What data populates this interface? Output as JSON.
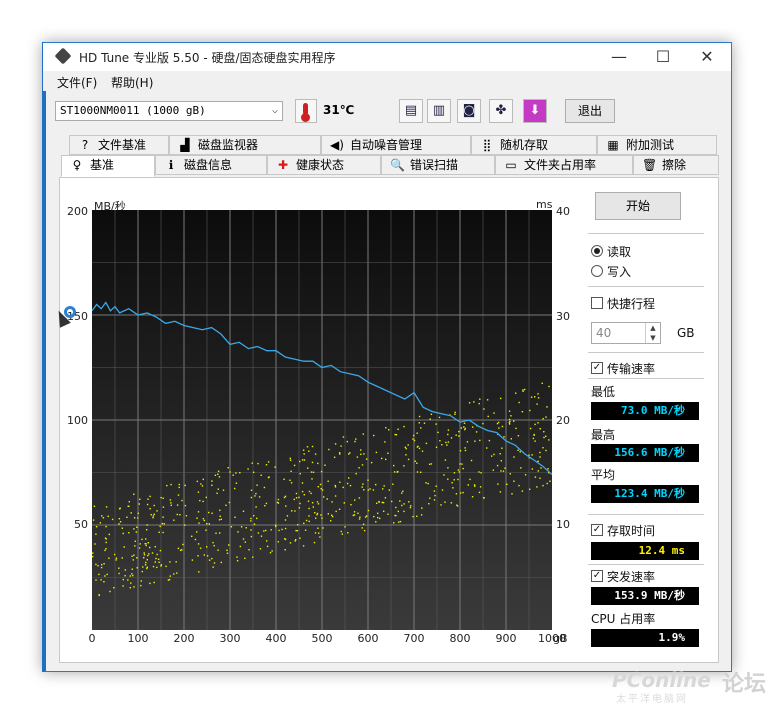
{
  "window": {
    "title": "HD Tune 专业版 5.50 - 硬盘/固态硬盘实用程序",
    "min_label": "—",
    "max_label": "☐",
    "close_label": "✕"
  },
  "menu": {
    "items": [
      {
        "label": "文件(F)"
      },
      {
        "label": "帮助(H)"
      }
    ]
  },
  "toolbar": {
    "drive": "ST1000NM0011 (1000 gB)",
    "temperature": "31℃",
    "exit_label": "退出",
    "icons": [
      {
        "name": "copy-info-icon",
        "glyph": "▤"
      },
      {
        "name": "copy-text-icon",
        "glyph": "▥"
      },
      {
        "name": "camera-icon",
        "glyph": "◙"
      },
      {
        "name": "options-icon",
        "glyph": "✤"
      },
      {
        "name": "save-down-icon",
        "glyph": "⬇"
      }
    ]
  },
  "tabs": {
    "row1": [
      {
        "label": "文件基准",
        "icon": "?"
      },
      {
        "label": "磁盘监视器",
        "icon": "▟"
      },
      {
        "label": "自动噪音管理",
        "icon": "◀)"
      },
      {
        "label": "随机存取",
        "icon": "⣿"
      },
      {
        "label": "附加测试",
        "icon": "▦"
      }
    ],
    "row2": [
      {
        "label": "基准",
        "icon": "♀"
      },
      {
        "label": "磁盘信息",
        "icon": "ℹ"
      },
      {
        "label": "健康状态",
        "icon": "✚"
      },
      {
        "label": "错误扫描",
        "icon": "🔍"
      },
      {
        "label": "文件夹占用率",
        "icon": "▭"
      },
      {
        "label": "擦除",
        "icon": "🗑"
      }
    ]
  },
  "side": {
    "start_label": "开始",
    "read_label": "读取",
    "write_label": "写入",
    "quick_label": "快捷行程",
    "quick_value": "40",
    "quick_unit": "GB",
    "transfer_label": "传输速率",
    "min_label": "最低",
    "min_value": "73.0 MB/秒",
    "max_label": "最高",
    "max_value": "156.6 MB/秒",
    "avg_label": "平均",
    "avg_value": "123.4 MB/秒",
    "access_label": "存取时间",
    "access_value": "12.4 ms",
    "burst_label": "突发速率",
    "burst_value": "153.9 MB/秒",
    "cpu_label": "CPU 占用率",
    "cpu_value": "1.9%"
  },
  "watermark": {
    "brand": "PConline",
    "sub": "太平洋电脑网",
    "forum": "论坛"
  },
  "chart_data": {
    "type": "line",
    "ylabel": "MB/秒",
    "y2label": "ms",
    "xunit": "gB",
    "xlim": [
      0,
      1000
    ],
    "ylim": [
      0,
      200
    ],
    "y2lim": [
      0,
      40
    ],
    "xticks": [
      "0",
      "100",
      "200",
      "300",
      "400",
      "500",
      "600",
      "700",
      "800",
      "900",
      "1000"
    ],
    "yticks": [
      "200",
      "150",
      "100",
      "50"
    ],
    "y2ticks": [
      "40",
      "30",
      "20",
      "10"
    ],
    "grid": true,
    "series": [
      {
        "kind": "line",
        "color": "#3aa8e8",
        "x": [
          0,
          10,
          20,
          30,
          40,
          50,
          60,
          80,
          100,
          120,
          140,
          160,
          180,
          200,
          220,
          240,
          260,
          280,
          300,
          320,
          340,
          360,
          380,
          400,
          420,
          440,
          460,
          480,
          500,
          520,
          540,
          560,
          580,
          600,
          620,
          640,
          660,
          680,
          700,
          720,
          740,
          760,
          780,
          800,
          820,
          840,
          860,
          880,
          900,
          920,
          940,
          960,
          980,
          1000
        ],
        "y": [
          152,
          155,
          153,
          156,
          152,
          154,
          151,
          153,
          150,
          151,
          149,
          146,
          147,
          145,
          144,
          143,
          144,
          141,
          136,
          137,
          134,
          135,
          133,
          133,
          130,
          129,
          128,
          128,
          125,
          126,
          123,
          122,
          121,
          118,
          116,
          114,
          112,
          110,
          113,
          106,
          104,
          103,
          102,
          99,
          100,
          97,
          95,
          94,
          90,
          88,
          84,
          81,
          78,
          74
        ]
      },
      {
        "kind": "scatter",
        "color": "#f2f000",
        "y2lim_band": {
          "x_start": 0,
          "x_end": 1000,
          "ms_low_start": 3,
          "ms_high_start": 12,
          "ms_low_end": 14,
          "ms_high_end": 24
        },
        "count": 700
      }
    ]
  }
}
